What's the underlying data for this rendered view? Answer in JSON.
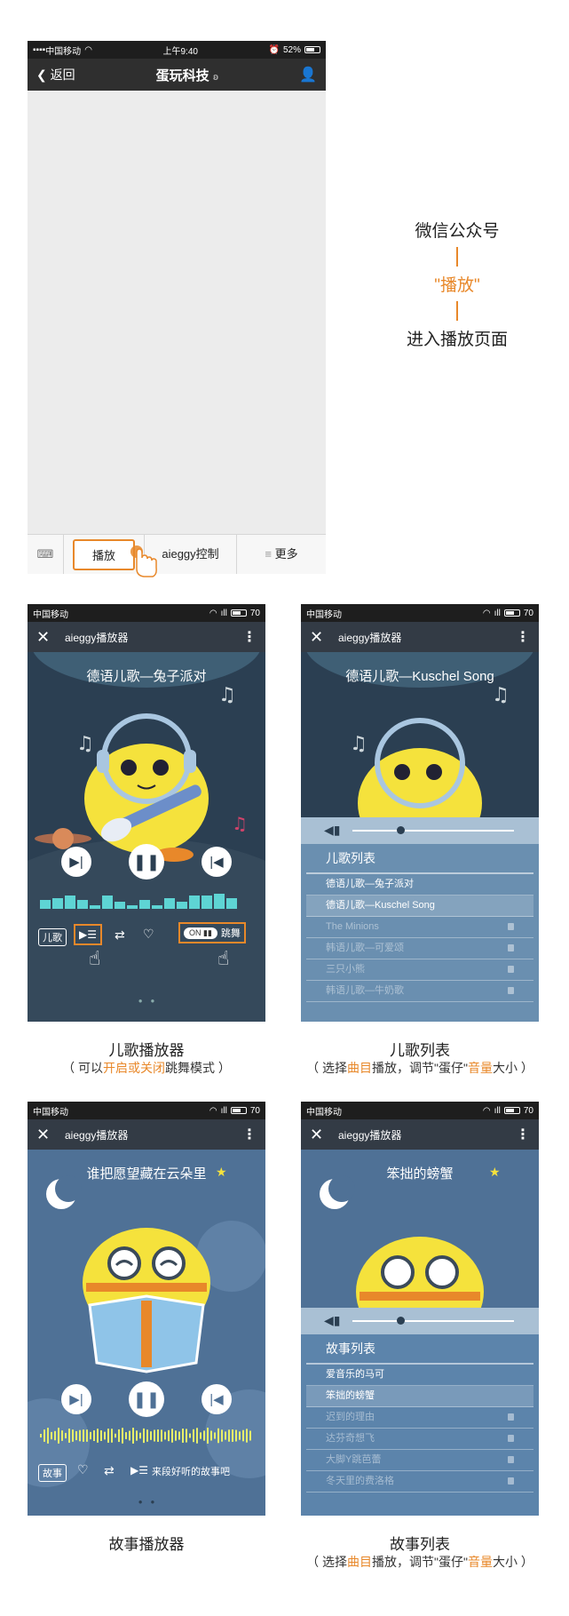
{
  "wechat": {
    "status": {
      "carrier": "中国移动",
      "time": "上午9:40",
      "battery": "52%"
    },
    "back_label": "返回",
    "title": "蛋玩科技",
    "menu": {
      "play": "播放",
      "control": "aieggy控制",
      "more": "更多"
    }
  },
  "annotation": {
    "line1": "微信公众号",
    "line2": "\"播放\"",
    "line3": "进入播放页面"
  },
  "player_common": {
    "carrier": "中国移动",
    "battery_level": "70",
    "title": "aieggy播放器"
  },
  "kids_player": {
    "song": "德语儿歌—兔子派对",
    "mode_label": "儿歌",
    "switch_on": "ON",
    "dance_label": "跳舞",
    "caption": "儿歌播放器",
    "sub_a": "（ 可以",
    "sub_b": "开启或关闭",
    "sub_c": "跳舞模式 ）"
  },
  "kids_list": {
    "song": "德语儿歌—Kuschel Song",
    "header": "儿歌列表",
    "items": [
      {
        "label": "德语儿歌—兔子派对",
        "locked": false,
        "active": false
      },
      {
        "label": "德语儿歌—Kuschel Song",
        "locked": false,
        "active": true
      },
      {
        "label": "The Minions",
        "locked": true,
        "active": false
      },
      {
        "label": "韩语儿歌—可爱颂",
        "locked": true,
        "active": false
      },
      {
        "label": "三只小熊",
        "locked": true,
        "active": false
      },
      {
        "label": "韩语儿歌—牛奶歌",
        "locked": true,
        "active": false
      }
    ],
    "caption": "儿歌列表"
  },
  "list_sub": {
    "a": "（ 选择",
    "b": "曲目",
    "c": "播放，调节\"蛋仔\"",
    "d": "音量",
    "e": "大小 ）"
  },
  "story_player": {
    "song": "谁把愿望藏在云朵里",
    "mode_label": "故事",
    "prompt": "来段好听的故事吧",
    "caption": "故事播放器"
  },
  "story_list": {
    "song": "笨拙的螃蟹",
    "header": "故事列表",
    "items": [
      {
        "label": "爱音乐的马可",
        "locked": false,
        "active": false
      },
      {
        "label": "笨拙的螃蟹",
        "locked": false,
        "active": true
      },
      {
        "label": "迟到的理由",
        "locked": true,
        "active": false
      },
      {
        "label": "达芬奇想飞",
        "locked": true,
        "active": false
      },
      {
        "label": "大脚Y跳芭蕾",
        "locked": true,
        "active": false
      },
      {
        "label": "冬天里的费洛格",
        "locked": true,
        "active": false
      }
    ],
    "caption": "故事列表"
  },
  "colors": {
    "accent": "#e8882a",
    "player_bg": "#2b3f52",
    "list_bg": "#6a8fb0"
  }
}
